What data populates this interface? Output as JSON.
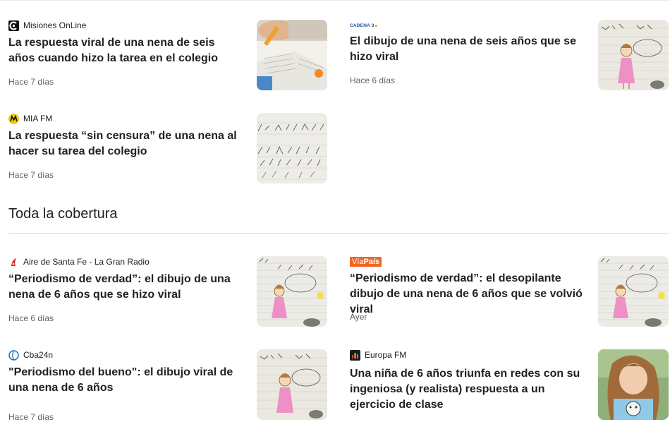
{
  "top_articles": [
    {
      "source": "Misiones OnLine",
      "logo": "misiones-online-logo",
      "title": "La respuesta viral de una nena de seis años cuando hizo la tarea en el colegio",
      "time": "Hace 7 días",
      "thumb": "homework-photo"
    },
    {
      "source": "",
      "logo": "cadena3-logo",
      "logo_text": "CADENA 3",
      "title": "El dibujo de una nena de seis años que se hizo viral",
      "time": "Hace 6 días",
      "thumb": "drawing-girl"
    },
    {
      "source": "MIA FM",
      "logo": "mia-fm-logo",
      "title": "La respuesta “sin censura” de una nena al hacer su tarea del colegio",
      "time": "Hace 7 días",
      "thumb": "notebook-page"
    }
  ],
  "section": {
    "title": "Toda la cobertura"
  },
  "coverage_articles": [
    {
      "source": "Aire de Santa Fe - La Gran Radio",
      "logo": "aire-santa-fe-logo",
      "title": "“Periodismo de verdad”: el dibujo de una nena de 6 años que se hizo viral",
      "time": "Hace 6 días",
      "thumb": "drawing-notebook"
    },
    {
      "source": "",
      "logo": "viapais-logo",
      "logo_text_a": "Vía",
      "logo_text_b": "País",
      "title": "“Periodismo de verdad”: el desopilante dibujo de una nena de 6 años que se volvió viral",
      "time": "Ayer",
      "thumb": "drawing-notebook"
    },
    {
      "source": "Cba24n",
      "logo": "cba24n-logo",
      "title": "\"Periodismo del bueno\": el dibujo viral de una nena de 6 años",
      "time": "Hace 7 días",
      "thumb": "drawing-girl"
    },
    {
      "source": "Europa FM",
      "logo": "europa-fm-logo",
      "title": "Una niña de 6 años triunfa en redes con su ingeniosa (y realista) respuesta a un ejercicio de clase",
      "time": "",
      "thumb": "child-photo"
    }
  ],
  "colors": {
    "accent_viapais": "#f26522",
    "text": "#202124",
    "muted": "#5f6368",
    "divider": "#dadce0"
  }
}
